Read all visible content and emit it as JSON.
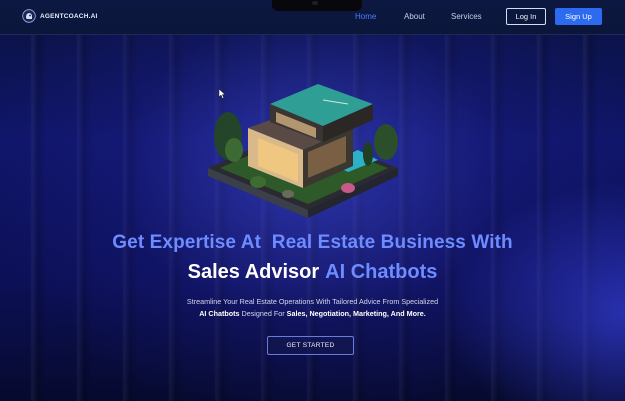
{
  "brand": {
    "name": "AGENTCOACH.AI",
    "icon": "robot-head-icon"
  },
  "nav": {
    "links": [
      {
        "label": "Home",
        "active": true
      },
      {
        "label": "About",
        "active": false
      },
      {
        "label": "Services",
        "active": false
      }
    ],
    "login_label": "Log In",
    "signup_label": "Sign Up"
  },
  "hero": {
    "image": "isometric-modern-house-illustration",
    "headline_line1": "Get Expertise At  Real Estate Business With",
    "headline_line2_white": "Sales Advisor",
    "headline_line2_blue": "AI Chatbots",
    "subtitle_line1": "Streamline Your Real Estate Operations With Tailored Advice From Specialized",
    "subtitle_line2_bold1": "AI Chatbots",
    "subtitle_line2_mid": " Designed For ",
    "subtitle_line2_bold2": "Sales, Negotiation, Marketing, And More.",
    "cta_label": "GET STARTED"
  },
  "colors": {
    "accent_blue": "#6d8cff",
    "signup_blue": "#2c6bf0",
    "nav_active": "#4d7dff",
    "background": "#0c1056"
  }
}
